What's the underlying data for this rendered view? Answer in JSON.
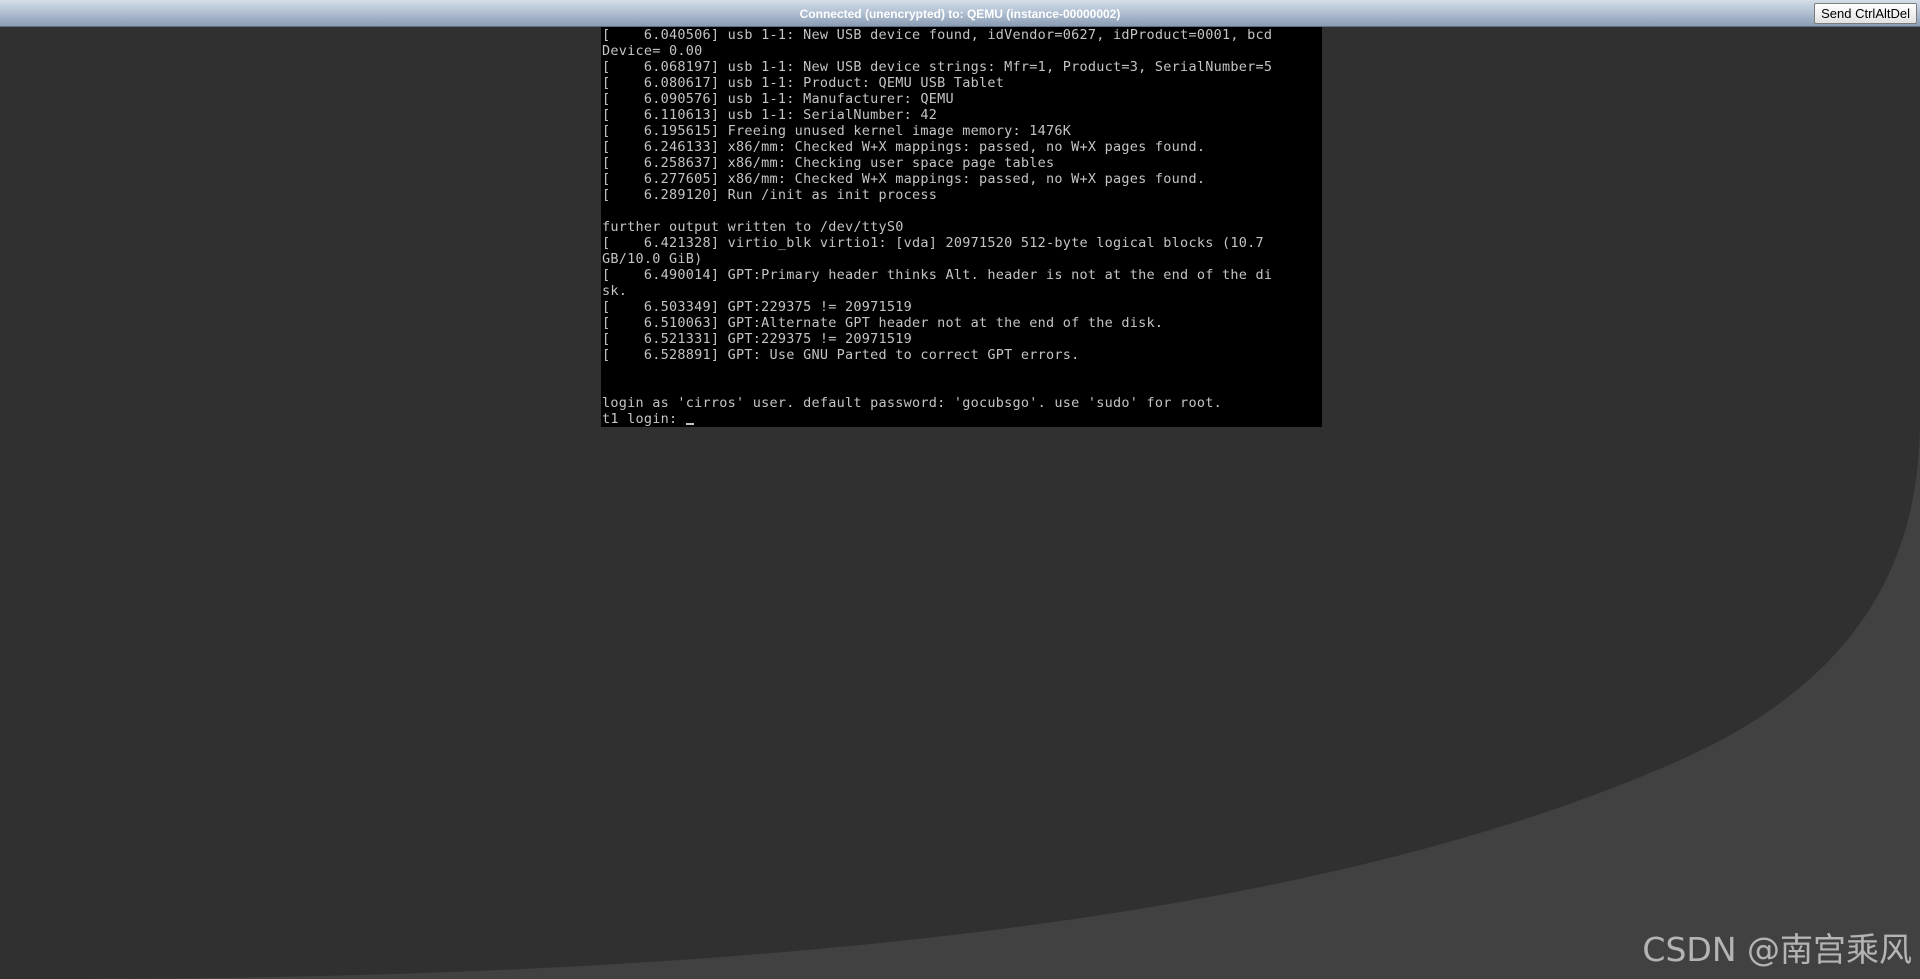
{
  "status_bar": {
    "title": "Connected (unencrypted) to: QEMU (instance-00000002)",
    "send_ctrl_alt_del_label": "Send CtrlAltDel"
  },
  "console": {
    "lines": [
      "[    6.040506] usb 1-1: New USB device found, idVendor=0627, idProduct=0001, bcd",
      "Device= 0.00",
      "[    6.068197] usb 1-1: New USB device strings: Mfr=1, Product=3, SerialNumber=5",
      "[    6.080617] usb 1-1: Product: QEMU USB Tablet",
      "[    6.090576] usb 1-1: Manufacturer: QEMU",
      "[    6.110613] usb 1-1: SerialNumber: 42",
      "[    6.195615] Freeing unused kernel image memory: 1476K",
      "[    6.246133] x86/mm: Checked W+X mappings: passed, no W+X pages found.",
      "[    6.258637] x86/mm: Checking user space page tables",
      "[    6.277605] x86/mm: Checked W+X mappings: passed, no W+X pages found.",
      "[    6.289120] Run /init as init process",
      "",
      "further output written to /dev/ttyS0",
      "[    6.421328] virtio_blk virtio1: [vda] 20971520 512-byte logical blocks (10.7",
      "GB/10.0 GiB)",
      "[    6.490014] GPT:Primary header thinks Alt. header is not at the end of the di",
      "sk.",
      "[    6.503349] GPT:229375 != 20971519",
      "[    6.510063] GPT:Alternate GPT header not at the end of the disk.",
      "[    6.521331] GPT:229375 != 20971519",
      "[    6.528891] GPT: Use GNU Parted to correct GPT errors.",
      "",
      "",
      "login as 'cirros' user. default password: 'gocubsgo'. use 'sudo' for root."
    ],
    "prompt": "t1 login: "
  },
  "watermark": "CSDN @南宫乘风",
  "colors": {
    "background": "#303030",
    "curve": "#414141",
    "console_bg": "#000000",
    "console_text": "#c4c4c4"
  }
}
